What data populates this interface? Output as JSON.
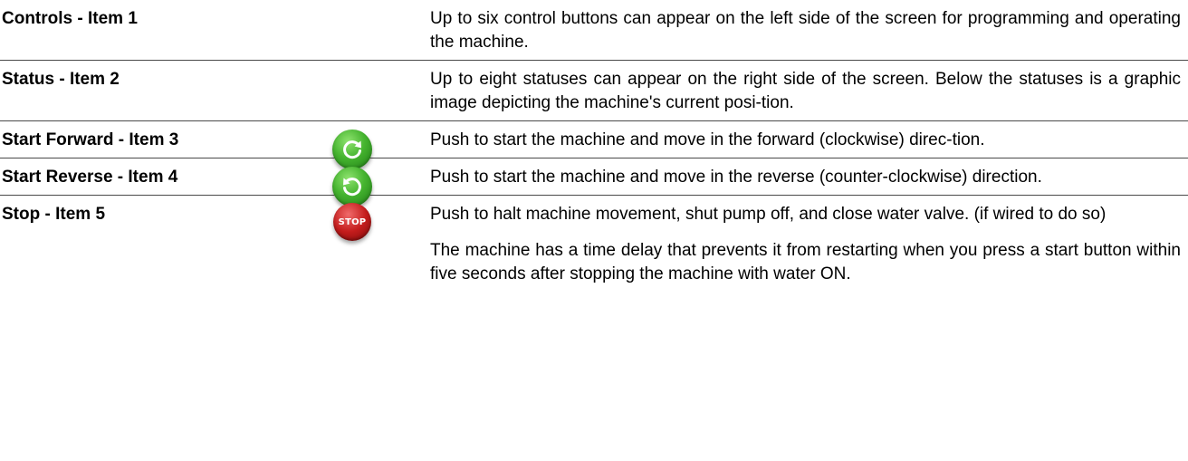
{
  "rows": [
    {
      "term": "Controls - Item 1",
      "description": "Up to six control buttons can appear on the left side of the screen for programming and operating the machine."
    },
    {
      "term": "Status - Item 2",
      "description": "Up to eight statuses can appear on the right side of the screen. Below the statuses is a graphic image depicting the machine's current posi-tion."
    },
    {
      "term": "Start Forward - Item 3",
      "icon": "start-forward-icon",
      "description": "Push to start the machine and move in the forward (clockwise) direc-tion."
    },
    {
      "term": "Start Reverse - Item 4",
      "icon": "start-reverse-icon",
      "description": "Push to start the machine and move in the reverse (counter-clockwise) direction."
    },
    {
      "term": "Stop - Item 5",
      "icon": "stop-icon",
      "icon_label": "STOP",
      "description": "Push to halt machine movement, shut pump off, and close water valve. (if wired to do so)",
      "note": "The machine has a time delay that prevents it from restarting when you press a start button within five seconds after stopping the machine with water ON."
    }
  ],
  "colors": {
    "start_button": "#45b42f",
    "stop_button": "#c41c1c",
    "divider": "#4a4a4a"
  }
}
